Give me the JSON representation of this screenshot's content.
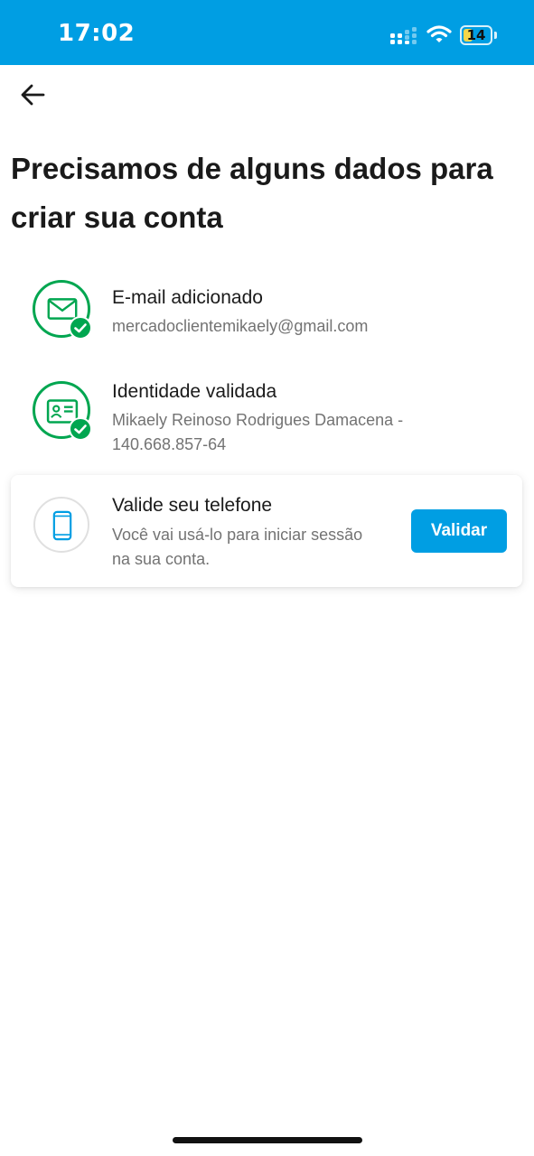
{
  "status_bar": {
    "time": "17:02",
    "battery_level": "14",
    "background_color": "#009ee3",
    "icons": [
      "signal-icon",
      "wifi-icon",
      "battery-icon"
    ]
  },
  "header": {
    "back_icon": "arrow-left-icon"
  },
  "title": "Precisamos de alguns dados para criar sua conta",
  "steps": [
    {
      "icon": "envelope-icon",
      "status": "done",
      "title": "E-mail adicionado",
      "subtitle": "mercadoclientemikaely@gmail.com"
    },
    {
      "icon": "id-card-icon",
      "status": "done",
      "title": "Identidade validada",
      "subtitle": "Mikaely Reinoso Rodrigues Damacena - 140.668.857-64"
    },
    {
      "icon": "phone-icon",
      "status": "pending",
      "title": "Valide seu telefone",
      "subtitle": "Você vai usá-lo para iniciar sessão na sua conta.",
      "action_label": "Validar"
    }
  ],
  "colors": {
    "accent": "#009ee3",
    "success": "#00a650",
    "text_secondary": "#737373"
  }
}
